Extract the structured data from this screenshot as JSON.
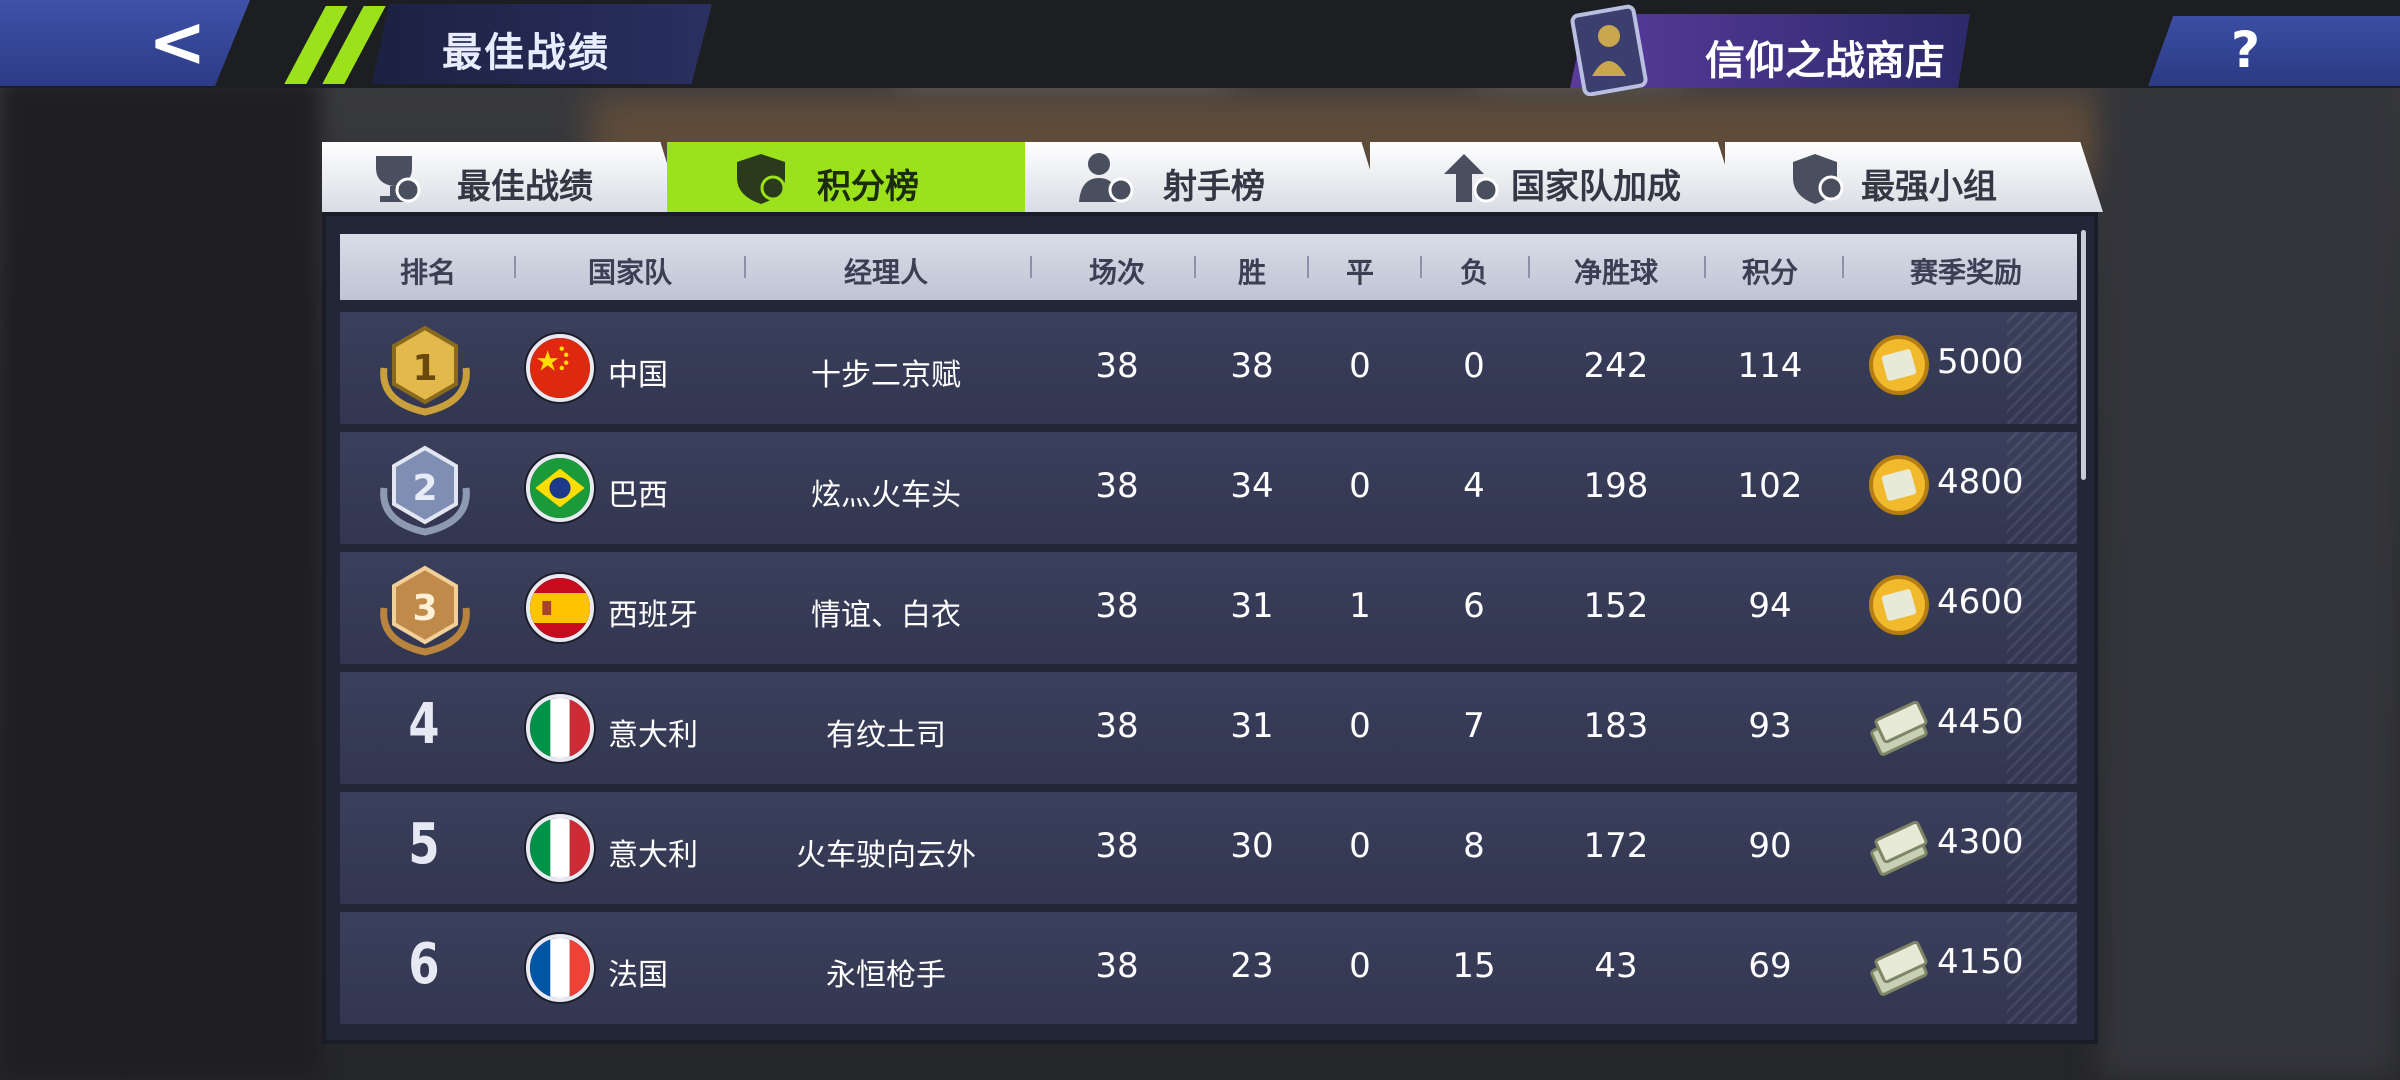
{
  "header": {
    "title": "最佳战绩",
    "shop_label": "信仰之战商店",
    "help_label": "?"
  },
  "tabs": [
    {
      "label": "最佳战绩",
      "active": false
    },
    {
      "label": "积分榜",
      "active": true
    },
    {
      "label": "射手榜",
      "active": false
    },
    {
      "label": "国家队加成",
      "active": false
    },
    {
      "label": "最强小组",
      "active": false
    }
  ],
  "table": {
    "columns": [
      "排名",
      "国家队",
      "经理人",
      "场次",
      "胜",
      "平",
      "负",
      "净胜球",
      "积分",
      "赛季奖励"
    ],
    "rows": [
      {
        "rank": "1",
        "team": "中国",
        "manager": "十步二京赋",
        "played": "38",
        "win": "38",
        "draw": "0",
        "loss": "0",
        "gd": "242",
        "pts": "114",
        "reward": "5000"
      },
      {
        "rank": "2",
        "team": "巴西",
        "manager": "炫灬火车头",
        "played": "38",
        "win": "34",
        "draw": "0",
        "loss": "4",
        "gd": "198",
        "pts": "102",
        "reward": "4800"
      },
      {
        "rank": "3",
        "team": "西班牙",
        "manager": "情谊、白衣",
        "played": "38",
        "win": "31",
        "draw": "1",
        "loss": "6",
        "gd": "152",
        "pts": "94",
        "reward": "4600"
      },
      {
        "rank": "4",
        "team": "意大利",
        "manager": "有纹土司",
        "played": "38",
        "win": "31",
        "draw": "0",
        "loss": "7",
        "gd": "183",
        "pts": "93",
        "reward": "4450"
      },
      {
        "rank": "5",
        "team": "意大利",
        "manager": "火车驶向云外",
        "played": "38",
        "win": "30",
        "draw": "0",
        "loss": "8",
        "gd": "172",
        "pts": "90",
        "reward": "4300"
      },
      {
        "rank": "6",
        "team": "法国",
        "manager": "永恒枪手",
        "played": "38",
        "win": "23",
        "draw": "0",
        "loss": "15",
        "gd": "43",
        "pts": "69",
        "reward": "4150"
      }
    ]
  },
  "colors": {
    "accent": "#9be21a",
    "nav_blue": "#3b4ea2",
    "row_bg": "#353a56"
  }
}
